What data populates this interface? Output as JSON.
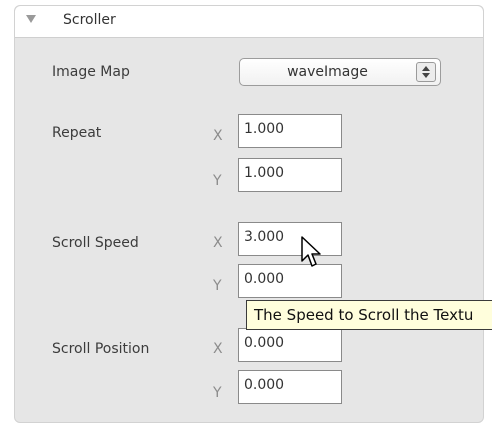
{
  "panel": {
    "title": "Scroller",
    "collapse_icon": "triangle-down-icon"
  },
  "image_map": {
    "label": "Image Map",
    "value": "waveImage",
    "stepper_icon": "up-down-stepper-icon"
  },
  "repeat": {
    "label": "Repeat",
    "x_axis": "X",
    "x_value": "1.000",
    "y_axis": "Y",
    "y_value": "1.000"
  },
  "scroll_speed": {
    "label": "Scroll Speed",
    "x_axis": "X",
    "x_value": "3.000",
    "y_axis": "Y",
    "y_value": "0.000"
  },
  "scroll_position": {
    "label": "Scroll Position",
    "x_axis": "X",
    "x_value": "0.000",
    "y_axis": "Y",
    "y_value": "0.000"
  },
  "tooltip": {
    "text": "The Speed to Scroll the Textu"
  },
  "cursor": {
    "icon": "arrow-pointer-icon"
  }
}
